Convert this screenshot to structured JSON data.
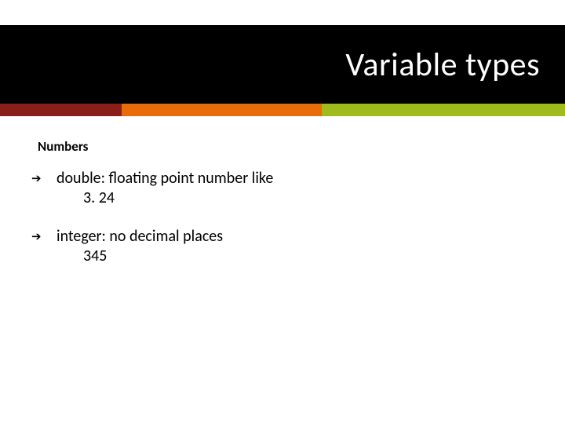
{
  "title": "Variable types",
  "subheading": "Numbers",
  "bullets": [
    {
      "main": "double: floating point number like",
      "sub": "3. 24"
    },
    {
      "main": "integer: no decimal places",
      "sub": "345"
    }
  ],
  "stripe_colors": {
    "seg1": "#8a1f18",
    "seg2": "#e86c0a",
    "seg3": "#9fbb1c"
  }
}
